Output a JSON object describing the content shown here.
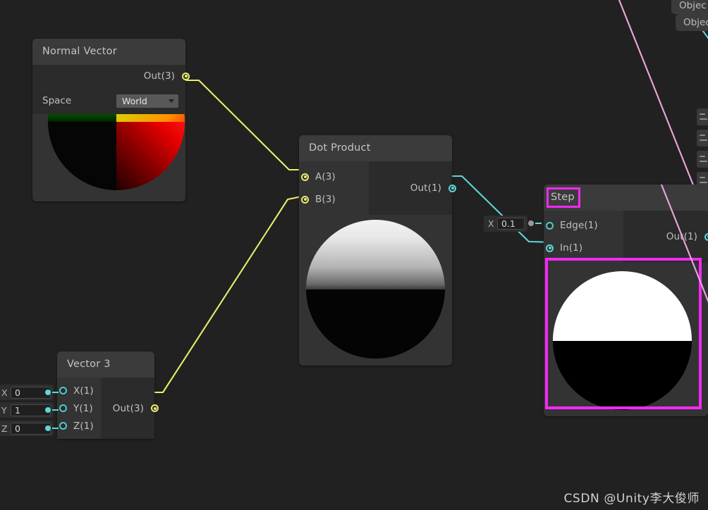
{
  "app": {
    "background_color": "#212121",
    "watermark": "CSDN @Unity李大俊师"
  },
  "nodes": {
    "normal_vector": {
      "title": "Normal Vector",
      "output_port": {
        "label": "Out(3)",
        "type": "vector3",
        "color": "#e9ec6b"
      },
      "property": {
        "label": "Space",
        "value": "World"
      },
      "preview": "normal-vector-sphere"
    },
    "dot_product": {
      "title": "Dot Product",
      "inputs": [
        {
          "label": "A(3)",
          "type": "vector3",
          "color": "#e9ec6b"
        },
        {
          "label": "B(3)",
          "type": "vector3",
          "color": "#e9ec6b"
        }
      ],
      "output_port": {
        "label": "Out(1)",
        "type": "float",
        "color": "#5fd6d6"
      },
      "preview": "dot-product-sphere"
    },
    "step": {
      "title": "Step",
      "selected": true,
      "highlight_color": "#f528f5",
      "inputs": [
        {
          "label": "Edge(1)",
          "type": "float",
          "connected": false
        },
        {
          "label": "In(1)",
          "type": "float",
          "connected": true
        }
      ],
      "output_port": {
        "label": "Out(1)",
        "type": "float",
        "color": "#5fd6d6"
      },
      "preview": "step-sphere"
    },
    "vector3": {
      "title": "Vector 3",
      "inputs": [
        {
          "label": "X(1)",
          "type": "float"
        },
        {
          "label": "Y(1)",
          "type": "float"
        },
        {
          "label": "Z(1)",
          "type": "float"
        }
      ],
      "output_port": {
        "label": "Out(3)",
        "type": "vector3",
        "color": "#e9ec6b"
      }
    }
  },
  "float_widgets": {
    "vector3_x": {
      "label": "X",
      "value": "0"
    },
    "vector3_y": {
      "label": "Y",
      "value": "1"
    },
    "vector3_z": {
      "label": "Z",
      "value": "0"
    },
    "step_edge": {
      "label": "X",
      "value": "0.1"
    }
  },
  "edge_nodes": {
    "object_1": "Objec",
    "object_2": "Objec"
  },
  "wires": [
    {
      "from": "normal_vector.Out(3)",
      "to": "dot_product.A(3)",
      "color": "#e9ec6b"
    },
    {
      "from": "vector3.Out(3)",
      "to": "dot_product.B(3)",
      "color": "#e9ec6b"
    },
    {
      "from": "dot_product.Out(1)",
      "to": "step.In(1)",
      "color": "#5fd6d6"
    },
    {
      "from": "step_edge_float",
      "to": "step.Edge(1)",
      "color": "#5fd6d6"
    },
    {
      "from": "step.Out(1)",
      "to": "offscreen-right",
      "color": "#5fd6d6"
    },
    {
      "from": "offscreen-top-left",
      "to": "offscreen-right",
      "color": "#e9a8e0"
    },
    {
      "from": "object_node",
      "to": "offscreen-right",
      "color": "#5fd6d6"
    }
  ]
}
